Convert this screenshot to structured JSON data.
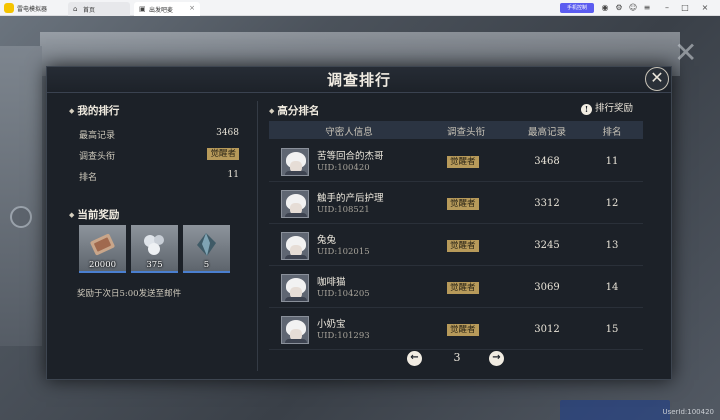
{
  "titlebar": {
    "app_name": "雷电模拟器",
    "tabs": [
      {
        "label": "首页",
        "icon": "home-icon"
      },
      {
        "label": "出发吧麦",
        "icon": "game-icon"
      }
    ],
    "mobile_button": "手机控制",
    "window_icons": [
      "gamepad-icon",
      "settings-icon",
      "account-icon",
      "menu-icon",
      "minimize-icon",
      "maximize-icon",
      "close-icon"
    ]
  },
  "modal": {
    "title": "调查排行"
  },
  "my_ranking": {
    "section_title": "我的排行",
    "stats": [
      {
        "label": "最高记录",
        "value": "3468"
      },
      {
        "label": "调查头衔",
        "value": "觉醒者"
      },
      {
        "label": "排名",
        "value": "11"
      }
    ]
  },
  "current_rewards": {
    "section_title": "当前奖励",
    "items": [
      {
        "count": "20000",
        "icon": "ticket-icon"
      },
      {
        "count": "375",
        "icon": "pearls-icon"
      },
      {
        "count": "5",
        "icon": "crystal-shard-icon"
      }
    ],
    "note": "奖励于次日5:00发送至邮件"
  },
  "high_score": {
    "section_title": "高分排名",
    "reward_link": "排行奖励",
    "columns": [
      "守密人信息",
      "调查头衔",
      "最高记录",
      "排名"
    ],
    "rows": [
      {
        "name": "苦等回合的杰哥",
        "uid": "UID:100420",
        "title": "觉醒者",
        "score": "3468",
        "rank": "11"
      },
      {
        "name": "触手的产后护理",
        "uid": "UID:108521",
        "title": "觉醒者",
        "score": "3312",
        "rank": "12"
      },
      {
        "name": "兔兔",
        "uid": "UID:102015",
        "title": "觉醒者",
        "score": "3245",
        "rank": "13"
      },
      {
        "name": "咖啡猫",
        "uid": "UID:104205",
        "title": "觉醒者",
        "score": "3069",
        "rank": "14"
      },
      {
        "name": "小奶宝",
        "uid": "UID:101293",
        "title": "觉醒者",
        "score": "3012",
        "rank": "15"
      }
    ],
    "page": "3"
  },
  "watermark": "UserId:100420",
  "colors": {
    "modal_bg": "#1c2128",
    "badge": "#b79a5a",
    "header_row": "#2b3442",
    "reward_accent": "#4a7fd0"
  }
}
